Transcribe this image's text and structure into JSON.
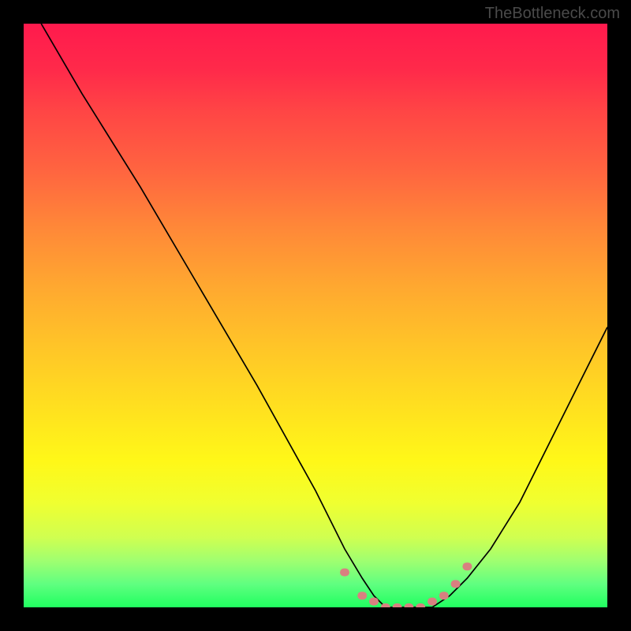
{
  "watermark": "TheBottleneck.com",
  "chart_data": {
    "type": "line",
    "title": "",
    "xlabel": "",
    "ylabel": "",
    "xlim": [
      0,
      100
    ],
    "ylim": [
      0,
      100
    ],
    "series": [
      {
        "name": "curve",
        "x": [
          3,
          10,
          20,
          30,
          40,
          50,
          55,
          58,
          60,
          62,
          65,
          68,
          70,
          73,
          76,
          80,
          85,
          90,
          95,
          100
        ],
        "y": [
          100,
          88,
          72,
          55,
          38,
          20,
          10,
          5,
          2,
          0,
          0,
          0,
          0,
          2,
          5,
          10,
          18,
          28,
          38,
          48
        ]
      }
    ],
    "markers": {
      "name": "highlight-region",
      "x": [
        55,
        58,
        60,
        62,
        64,
        66,
        68,
        70,
        72,
        74,
        76
      ],
      "y": [
        6,
        2,
        1,
        0,
        0,
        0,
        0,
        1,
        2,
        4,
        7
      ]
    },
    "background_gradient": {
      "top": "#ff1a4d",
      "bottom": "#20ff60"
    }
  }
}
